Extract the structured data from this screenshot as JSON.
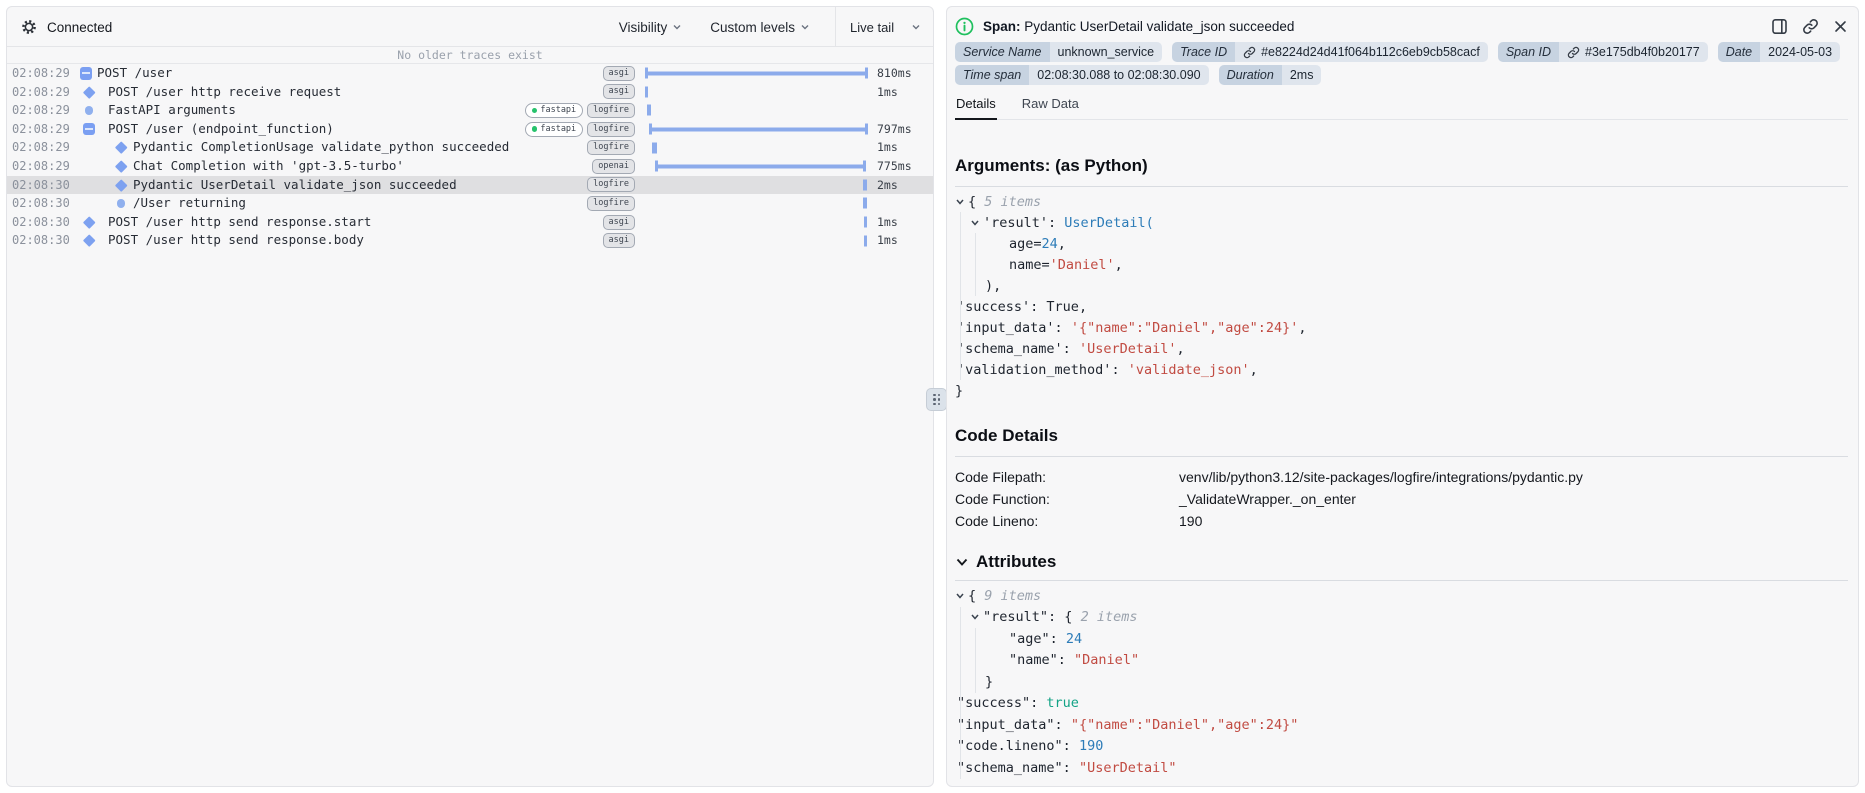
{
  "left_panel": {
    "status": "Connected",
    "toolbar": {
      "visibility": "Visibility",
      "custom_levels": "Custom levels",
      "live_tail": "Live tail"
    },
    "notice": "No older traces exist",
    "rows": [
      {
        "time": "02:08:29",
        "level": 0,
        "icon": "collapse",
        "name": "POST /user",
        "tags": [
          "asgi"
        ],
        "bar": {
          "type": "span",
          "start": 0,
          "end": 100
        },
        "duration": "810ms",
        "selected": false
      },
      {
        "time": "02:08:29",
        "level": 1,
        "icon": "diamond",
        "name": "POST /user http receive request",
        "tags": [
          "asgi"
        ],
        "bar": {
          "type": "tick",
          "start": 0,
          "w": 3
        },
        "duration": "1ms",
        "selected": false
      },
      {
        "time": "02:08:29",
        "level": 1,
        "icon": "circle",
        "name": "FastAPI arguments",
        "tags": [
          "fastapi",
          "logfire"
        ],
        "bar": {
          "type": "tick",
          "start": 0.8,
          "w": 4
        },
        "duration": "",
        "selected": false
      },
      {
        "time": "02:08:29",
        "level": 1,
        "icon": "collapse",
        "name": "POST /user (endpoint_function)",
        "tags": [
          "fastapi",
          "logfire"
        ],
        "bar": {
          "type": "span",
          "start": 1.8,
          "end": 99.8
        },
        "duration": "797ms",
        "selected": false
      },
      {
        "time": "02:08:29",
        "level": 2,
        "icon": "diamond",
        "name": "Pydantic CompletionUsage validate_python succeeded",
        "tags": [
          "logfire"
        ],
        "bar": {
          "type": "tick",
          "start": 3,
          "w": 5
        },
        "duration": "1ms",
        "selected": false
      },
      {
        "time": "02:08:29",
        "level": 2,
        "icon": "diamond",
        "name": "Chat Completion with 'gpt-3.5-turbo'",
        "tags": [
          "openai"
        ],
        "bar": {
          "type": "span",
          "start": 4.5,
          "end": 99.3
        },
        "duration": "775ms",
        "selected": false
      },
      {
        "time": "02:08:30",
        "level": 2,
        "icon": "diamond",
        "name": "Pydantic UserDetail validate_json succeeded",
        "tags": [
          "logfire"
        ],
        "bar": {
          "type": "tick",
          "start": 97.8,
          "w": 4
        },
        "duration": "2ms",
        "selected": true
      },
      {
        "time": "02:08:30",
        "level": 2,
        "icon": "circle",
        "name": "/User returning",
        "tags": [
          "logfire"
        ],
        "bar": {
          "type": "tick",
          "start": 97.8,
          "w": 4
        },
        "duration": "",
        "selected": false
      },
      {
        "time": "02:08:30",
        "level": 1,
        "icon": "diamond",
        "name": "POST /user http send response.start",
        "tags": [
          "asgi"
        ],
        "bar": {
          "type": "tick",
          "start": 98.4,
          "w": 3
        },
        "duration": "1ms",
        "selected": false
      },
      {
        "time": "02:08:30",
        "level": 1,
        "icon": "diamond",
        "name": "POST /user http send response.body",
        "tags": [
          "asgi"
        ],
        "bar": {
          "type": "tick",
          "start": 98.4,
          "w": 3
        },
        "duration": "1ms",
        "selected": false
      }
    ]
  },
  "right_panel": {
    "span_label": "Span:",
    "span_title": "Pydantic UserDetail validate_json succeeded",
    "badges": [
      {
        "label": "Service Name",
        "value": "unknown_service",
        "link": false
      },
      {
        "label": "Trace ID",
        "value": "#e8224d24d41f064b112c6eb9cb58cacf",
        "link": true
      },
      {
        "label": "Span ID",
        "value": "#3e175db4f0b20177",
        "link": true
      },
      {
        "label": "Date",
        "value": "2024-05-03",
        "link": false
      },
      {
        "label": "Time span",
        "value": "02:08:30.088 to 02:08:30.090",
        "link": false
      },
      {
        "label": "Duration",
        "value": "2ms",
        "link": false
      }
    ],
    "tabs": [
      {
        "label": "Details",
        "active": true
      },
      {
        "label": "Raw Data",
        "active": false
      }
    ],
    "arguments_heading": "Arguments: (as Python)",
    "python_lines": [
      {
        "ind": 0,
        "chev": true,
        "toks": [
          [
            "{ ",
            "pn"
          ],
          [
            "5 items",
            "meta"
          ]
        ]
      },
      {
        "ind": 15,
        "chev": true,
        "toks": [
          [
            "'result'",
            "key"
          ],
          [
            ": ",
            "pn"
          ],
          [
            "UserDetail(",
            "cls"
          ]
        ]
      },
      {
        "ind": 54,
        "chev": false,
        "toks": [
          [
            "age=",
            "pn"
          ],
          [
            "24",
            "num"
          ],
          [
            ",",
            "pn"
          ]
        ]
      },
      {
        "ind": 54,
        "chev": false,
        "toks": [
          [
            "name=",
            "pn"
          ],
          [
            "'Daniel'",
            "str"
          ],
          [
            ",",
            "pn"
          ]
        ]
      },
      {
        "ind": 30,
        "chev": false,
        "toks": [
          [
            "),",
            "pn"
          ]
        ]
      },
      {
        "ind": 2,
        "chev": false,
        "toks": [
          [
            "'success'",
            "key"
          ],
          [
            ": ",
            "pn"
          ],
          [
            "True",
            "boolpy"
          ],
          [
            ",",
            "pn"
          ]
        ]
      },
      {
        "ind": 2,
        "chev": false,
        "toks": [
          [
            "'input_data'",
            "key"
          ],
          [
            ": ",
            "pn"
          ],
          [
            "'{\"name\":\"Daniel\",\"age\":24}'",
            "str"
          ],
          [
            ",",
            "pn"
          ]
        ]
      },
      {
        "ind": 2,
        "chev": false,
        "toks": [
          [
            "'schema_name'",
            "key"
          ],
          [
            ": ",
            "pn"
          ],
          [
            "'UserDetail'",
            "str"
          ],
          [
            ",",
            "pn"
          ]
        ]
      },
      {
        "ind": 2,
        "chev": false,
        "toks": [
          [
            "'validation_method'",
            "key"
          ],
          [
            ": ",
            "pn"
          ],
          [
            "'validate_json'",
            "str"
          ],
          [
            ",",
            "pn"
          ]
        ]
      },
      {
        "ind": 0,
        "chev": false,
        "toks": [
          [
            "}",
            "pn"
          ]
        ]
      }
    ],
    "code_details_heading": "Code Details",
    "code_details": [
      {
        "label": "Code Filepath:",
        "value": "venv/lib/python3.12/site-packages/logfire/integrations/pydantic.py"
      },
      {
        "label": "Code Function:",
        "value": "_ValidateWrapper._on_enter"
      },
      {
        "label": "Code Lineno:",
        "value": "190"
      }
    ],
    "attributes_heading": "Attributes",
    "attribute_lines": [
      {
        "ind": 0,
        "chev": true,
        "toks": [
          [
            "{ ",
            "pn"
          ],
          [
            "9 items",
            "meta"
          ]
        ]
      },
      {
        "ind": 15,
        "chev": true,
        "toks": [
          [
            "\"result\"",
            "key"
          ],
          [
            ": ",
            "pn"
          ],
          [
            "{ ",
            "pn"
          ],
          [
            "2 items",
            "meta"
          ]
        ]
      },
      {
        "ind": 54,
        "chev": false,
        "toks": [
          [
            "\"age\"",
            "key"
          ],
          [
            ": ",
            "pn"
          ],
          [
            "24",
            "num"
          ]
        ]
      },
      {
        "ind": 54,
        "chev": false,
        "toks": [
          [
            "\"name\"",
            "key"
          ],
          [
            ": ",
            "pn"
          ],
          [
            "\"Daniel\"",
            "str"
          ]
        ]
      },
      {
        "ind": 30,
        "chev": false,
        "toks": [
          [
            "}",
            "pn"
          ]
        ]
      },
      {
        "ind": 2,
        "chev": false,
        "toks": [
          [
            "\"success\"",
            "key"
          ],
          [
            ": ",
            "pn"
          ],
          [
            "true",
            "bool"
          ]
        ]
      },
      {
        "ind": 2,
        "chev": false,
        "toks": [
          [
            "\"input_data\"",
            "key"
          ],
          [
            ": ",
            "pn"
          ],
          [
            "\"{\"name\":\"Daniel\",\"age\":24}\"",
            "str"
          ]
        ]
      },
      {
        "ind": 2,
        "chev": false,
        "toks": [
          [
            "\"code.lineno\"",
            "key"
          ],
          [
            ": ",
            "pn"
          ],
          [
            "190",
            "num"
          ]
        ]
      },
      {
        "ind": 2,
        "chev": false,
        "toks": [
          [
            "\"schema_name\"",
            "key"
          ],
          [
            ": ",
            "pn"
          ],
          [
            "\"UserDetail\"",
            "str"
          ]
        ]
      }
    ]
  }
}
